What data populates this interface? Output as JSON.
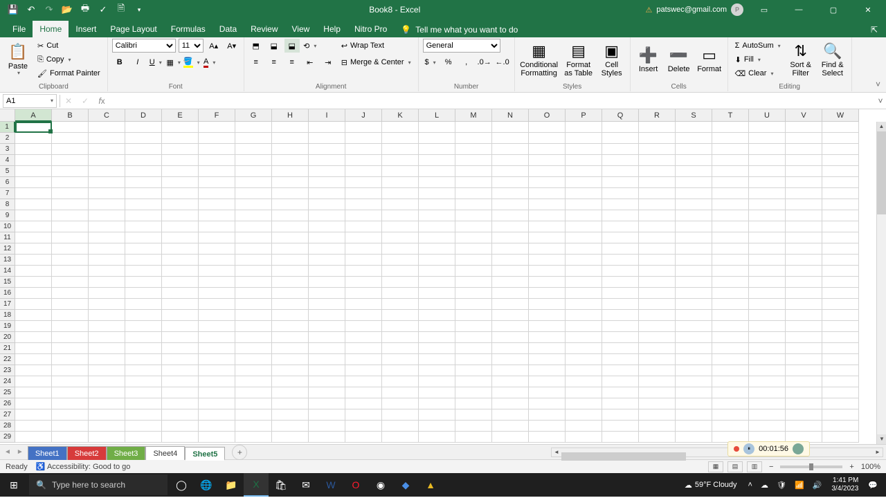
{
  "title_bar": {
    "doc_title": "Book8 - Excel",
    "user_email": "patswec@gmail.com",
    "user_initial": "P"
  },
  "ribbon_tabs": {
    "file": "File",
    "home": "Home",
    "insert": "Insert",
    "page_layout": "Page Layout",
    "formulas": "Formulas",
    "data": "Data",
    "review": "Review",
    "view": "View",
    "help": "Help",
    "nitro": "Nitro Pro",
    "tellme": "Tell me what you want to do"
  },
  "ribbon": {
    "clipboard": {
      "paste": "Paste",
      "cut": "Cut",
      "copy": "Copy",
      "format_painter": "Format Painter",
      "label": "Clipboard"
    },
    "font": {
      "name": "Calibri",
      "size": "11",
      "label": "Font"
    },
    "alignment": {
      "wrap": "Wrap Text",
      "merge": "Merge & Center",
      "label": "Alignment"
    },
    "number": {
      "format": "General",
      "label": "Number"
    },
    "styles": {
      "cond": "Conditional Formatting",
      "table": "Format as Table",
      "cell": "Cell Styles",
      "label": "Styles"
    },
    "cells": {
      "insert": "Insert",
      "delete": "Delete",
      "format": "Format",
      "label": "Cells"
    },
    "editing": {
      "autosum": "AutoSum",
      "fill": "Fill",
      "clear": "Clear",
      "sort": "Sort & Filter",
      "find": "Find & Select",
      "label": "Editing"
    }
  },
  "name_box": "A1",
  "formula_bar_value": "",
  "columns": [
    "A",
    "B",
    "C",
    "D",
    "E",
    "F",
    "G",
    "H",
    "I",
    "J",
    "K",
    "L",
    "M",
    "N",
    "O",
    "P",
    "Q",
    "R",
    "S",
    "T",
    "U",
    "V",
    "W"
  ],
  "rows": [
    1,
    2,
    3,
    4,
    5,
    6,
    7,
    8,
    9,
    10,
    11,
    12,
    13,
    14,
    15,
    16,
    17,
    18,
    19,
    20,
    21,
    22,
    23,
    24,
    25,
    26,
    27,
    28,
    29
  ],
  "active_cell": "A1",
  "sheet_tabs": [
    {
      "name": "Sheet1",
      "color": "blue"
    },
    {
      "name": "Sheet2",
      "color": "red"
    },
    {
      "name": "Sheet3",
      "color": "green"
    },
    {
      "name": "Sheet4",
      "color": "plain"
    },
    {
      "name": "Sheet5",
      "color": "active"
    }
  ],
  "recording": {
    "time": "00:01:56"
  },
  "status_bar": {
    "ready": "Ready",
    "accessibility": "Accessibility: Good to go",
    "zoom": "100%"
  },
  "taskbar": {
    "search_placeholder": "Type here to search",
    "weather": "59°F Cloudy",
    "time": "1:41 PM",
    "date": "3/4/2023"
  }
}
